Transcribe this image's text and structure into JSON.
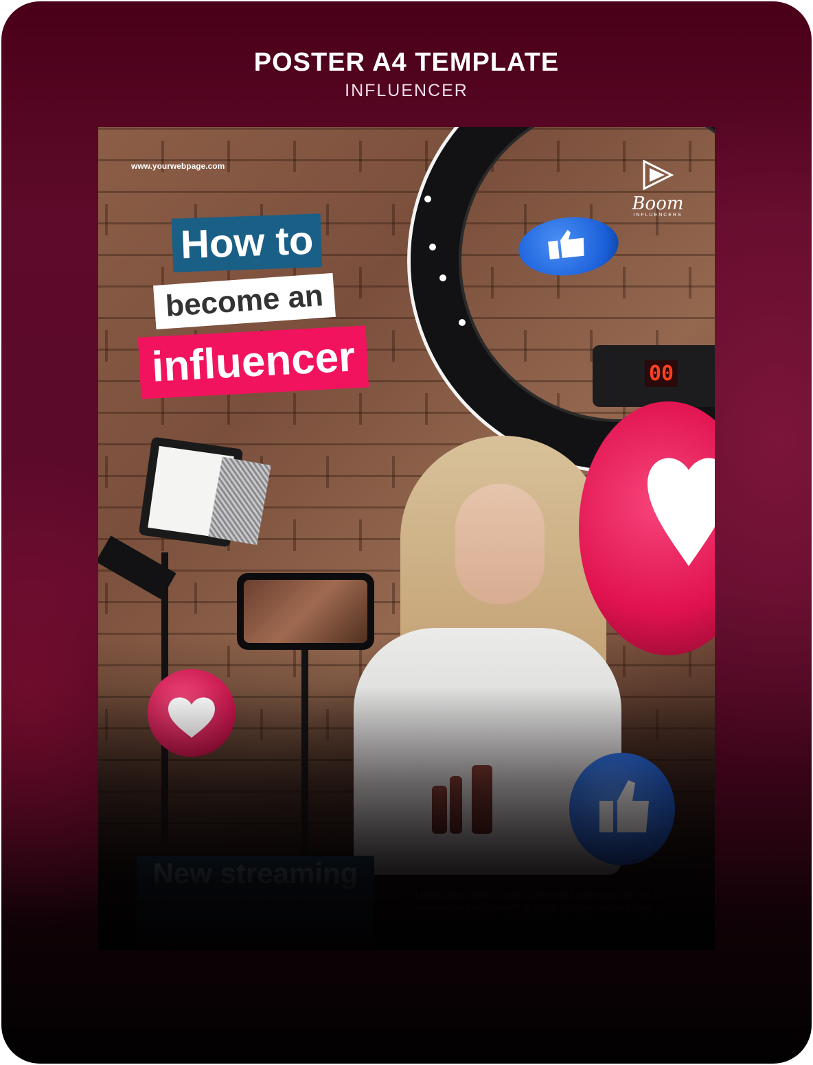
{
  "header": {
    "title": "POSTER A4 TEMPLATE",
    "subtitle": "INFLUENCER"
  },
  "poster": {
    "website": "www.yourwebpage.com",
    "headline": {
      "line1": "How to",
      "line2": "become an",
      "line3": "influencer"
    },
    "logo": {
      "name": "Boom",
      "tagline": "INFLUENCERS"
    },
    "counter": "00",
    "promo": "New streaming",
    "body_text": "Lorem ipsum dolor sit amet, consectetur adipiscing elit, sed do eiusmod tempor incididunt ut labore et dolore magna aliqua."
  },
  "colors": {
    "background": "#5a0a2a",
    "headline_blue": "#1a5f86",
    "headline_pink": "#f2135e",
    "reaction_like": "#1a5fd8",
    "reaction_heart": "#e0124f"
  },
  "icons": [
    "play-logo-icon",
    "thumbs-up-icon",
    "heart-icon"
  ]
}
